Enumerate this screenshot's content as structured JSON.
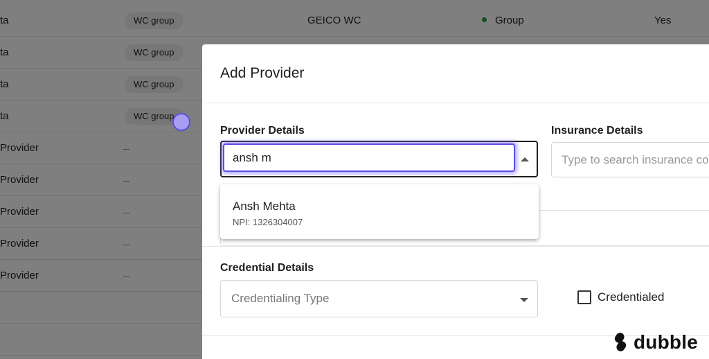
{
  "background_table": {
    "rows": [
      {
        "name": "ta",
        "group": "WC group",
        "insurance": "GEICO WC",
        "type": "Group",
        "flag": "Yes"
      },
      {
        "name": "ta",
        "group": "WC group"
      },
      {
        "name": "ta",
        "group": "WC group"
      },
      {
        "name": "ta",
        "group": "WC group"
      },
      {
        "name": "Provider",
        "group": "--"
      },
      {
        "name": "Provider",
        "group": "--"
      },
      {
        "name": "Provider",
        "group": "--"
      },
      {
        "name": "Provider",
        "group": "--"
      },
      {
        "name": "Provider",
        "group": "--"
      },
      {
        "name": ""
      },
      {
        "name": ""
      }
    ]
  },
  "modal": {
    "title": "Add Provider",
    "provider_details": {
      "label": "Provider Details",
      "value": "ansh m",
      "options": [
        {
          "name": "Ansh Mehta",
          "npi": "NPI: 1326304007"
        }
      ]
    },
    "insurance_details": {
      "label": "Insurance Details",
      "placeholder": "Type to search insurance co"
    },
    "credential_details": {
      "label": "Credential Details",
      "type_placeholder": "Credentialing Type",
      "checkbox_label": "Credentialed",
      "checked": false
    }
  },
  "brand": {
    "name": "dubble"
  },
  "colors": {
    "focus": "#5b4ee0",
    "status_dot": "#2e9e3a"
  }
}
